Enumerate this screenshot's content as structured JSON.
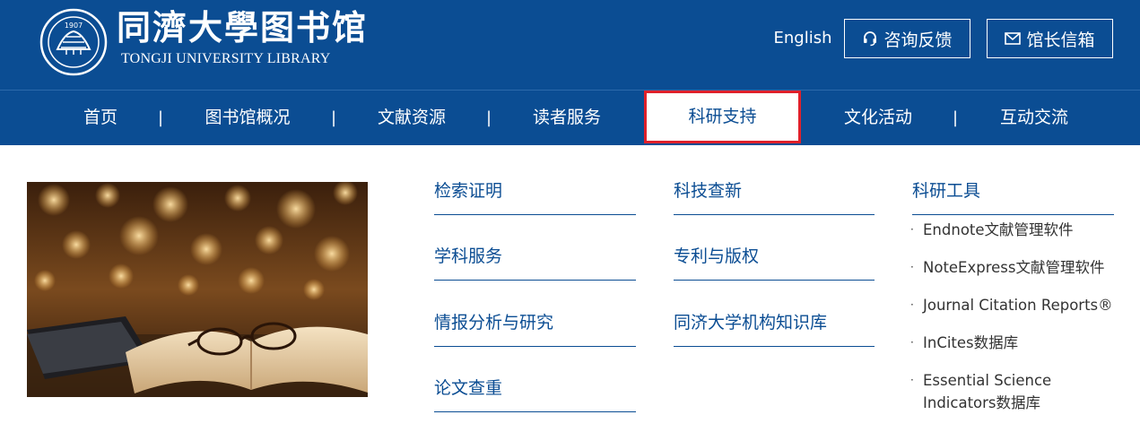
{
  "header": {
    "logo_cn": "同濟大學图书馆",
    "logo_en": "TONGJI UNIVERSITY LIBRARY",
    "seal_text": "1907",
    "lang_link": "English",
    "consult_button": "咨询反馈",
    "mailbox_button": "馆长信箱",
    "brand_color": "#0b4d93"
  },
  "nav": {
    "items": [
      {
        "label": "首页"
      },
      {
        "label": "图书馆概况"
      },
      {
        "label": "文献资源"
      },
      {
        "label": "读者服务"
      },
      {
        "label": "科研支持",
        "active": true
      },
      {
        "label": "文化活动"
      },
      {
        "label": "互动交流"
      }
    ],
    "separator": "|",
    "highlight_color": "#e0202a"
  },
  "menu": {
    "column1": [
      "检索证明",
      "学科服务",
      "情报分析与研究",
      "论文查重"
    ],
    "column2": [
      "科技查新",
      "专利与版权",
      "同济大学机构知识库"
    ],
    "column3": {
      "heading": "科研工具",
      "bullet": "·",
      "items": [
        "Endnote文献管理软件",
        "NoteExpress文献管理软件",
        "Journal Citation Reports®",
        "InCites数据库",
        "Essential Science Indicators数据库"
      ]
    }
  }
}
